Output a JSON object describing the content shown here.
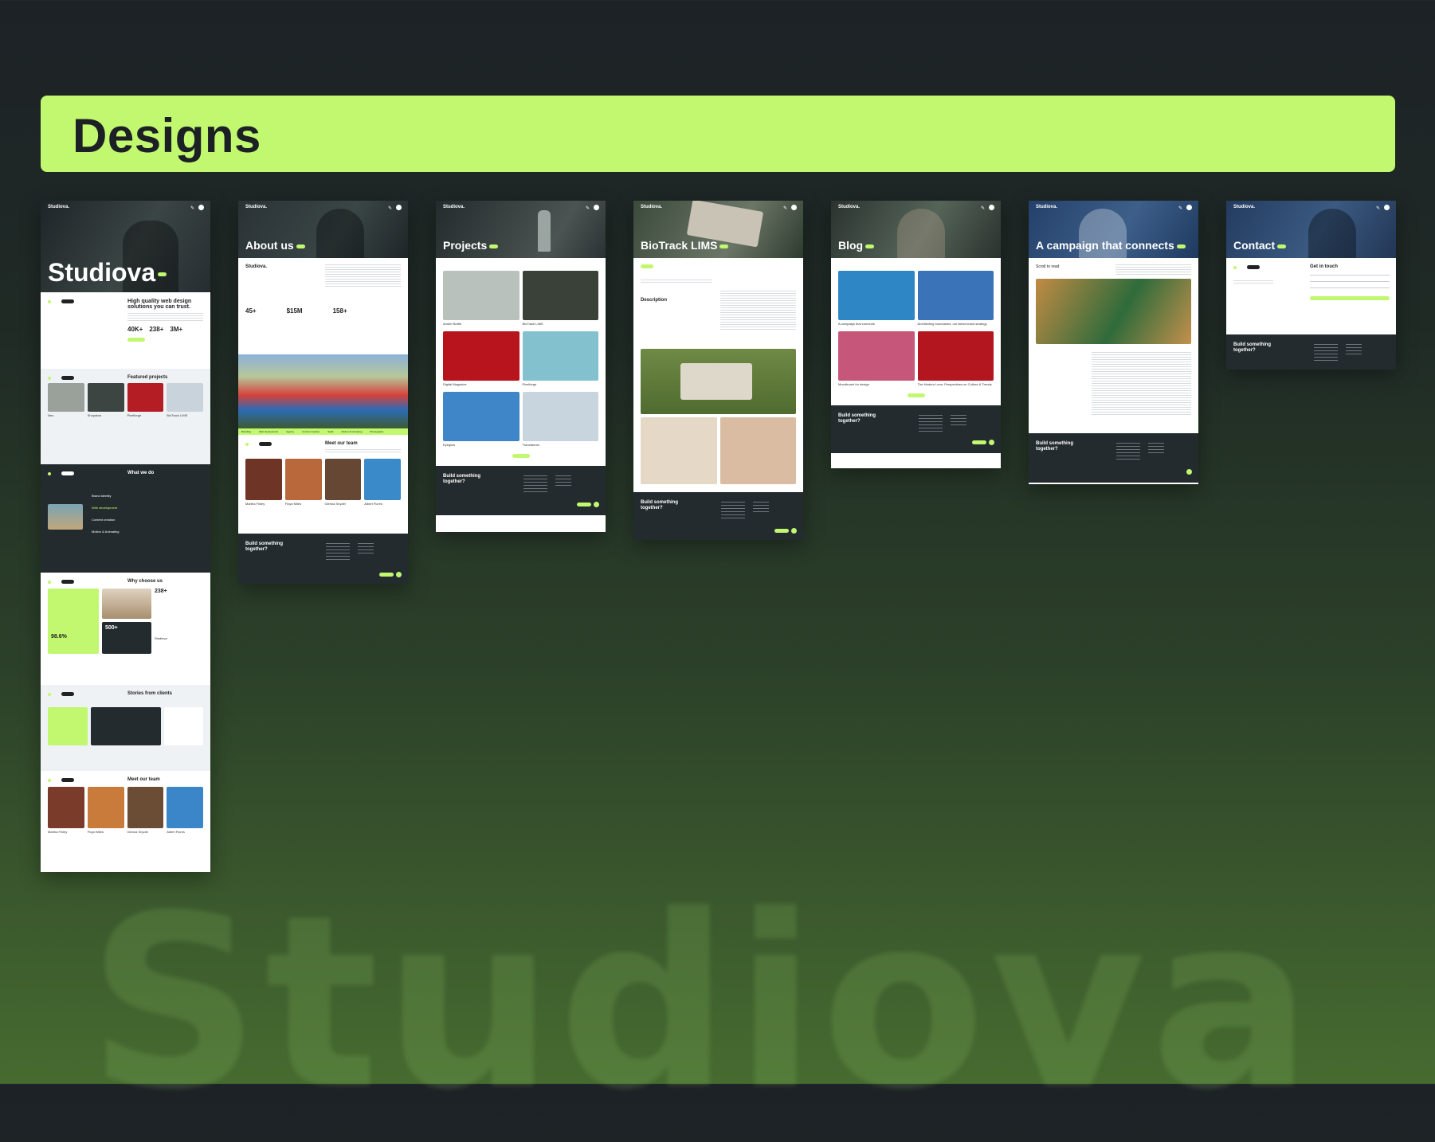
{
  "watermark": "Studiova",
  "banner": {
    "title": "Designs"
  },
  "brand": "Studiova.",
  "home": {
    "hero_title": "Studiova",
    "intro_title": "High quality web design solutions you can trust.",
    "stats": [
      "40K+",
      "238+",
      "3M+"
    ],
    "featured_title": "Featured projects",
    "featured": [
      "Neo",
      "Shopabar",
      "Pixelforge",
      "BioTrack LIMS"
    ],
    "what_title": "What we do",
    "services": [
      "Brand identity",
      "Web development",
      "Content creation",
      "Motion & Animating"
    ],
    "why_title": "Why choose us",
    "why_stats": [
      "98.6%",
      "238+",
      "500+"
    ],
    "why_label": "Studiova",
    "stories_title": "Stories from clients",
    "team_title": "Meet our team",
    "team": [
      "Martha Finley",
      "Floyd Miles",
      "Glenna Snyder",
      "Albert Flores"
    ]
  },
  "about": {
    "hero_title": "About us",
    "brand": "Studiova.",
    "stats": [
      "45+",
      "$15M",
      "158+"
    ],
    "ticker": [
      "Branding",
      "Web development",
      "Agency",
      "Content creation",
      "SaaS",
      "Motion & Animating",
      "Photography"
    ],
    "team_title": "Meet our team",
    "team": [
      "Martha Finley",
      "Floyd Miles",
      "Glenna Snyder",
      "Albert Flores"
    ]
  },
  "projects": {
    "hero_title": "Projects",
    "items": [
      "Amber Bottle",
      "BioTrack LIMS",
      "Digital Magazine",
      "Pixelforge",
      "Eyeglow",
      "Transfarmer"
    ]
  },
  "biotrack": {
    "hero_title": "BioTrack LIMS",
    "description": "Description"
  },
  "blog": {
    "hero_title": "Blog",
    "posts": [
      "A campaign that connects",
      "Architecting boundaries: our latest brand strategy",
      "Moodboard for design",
      "The Modern Lens: Perspectives on Culture & Trends"
    ]
  },
  "campaign": {
    "hero_title": "A campaign that connects",
    "scroll": "Scroll to read"
  },
  "contact": {
    "hero_title": "Contact",
    "form_title": "Get in touch"
  },
  "footer": {
    "cta": "Build something together?"
  }
}
